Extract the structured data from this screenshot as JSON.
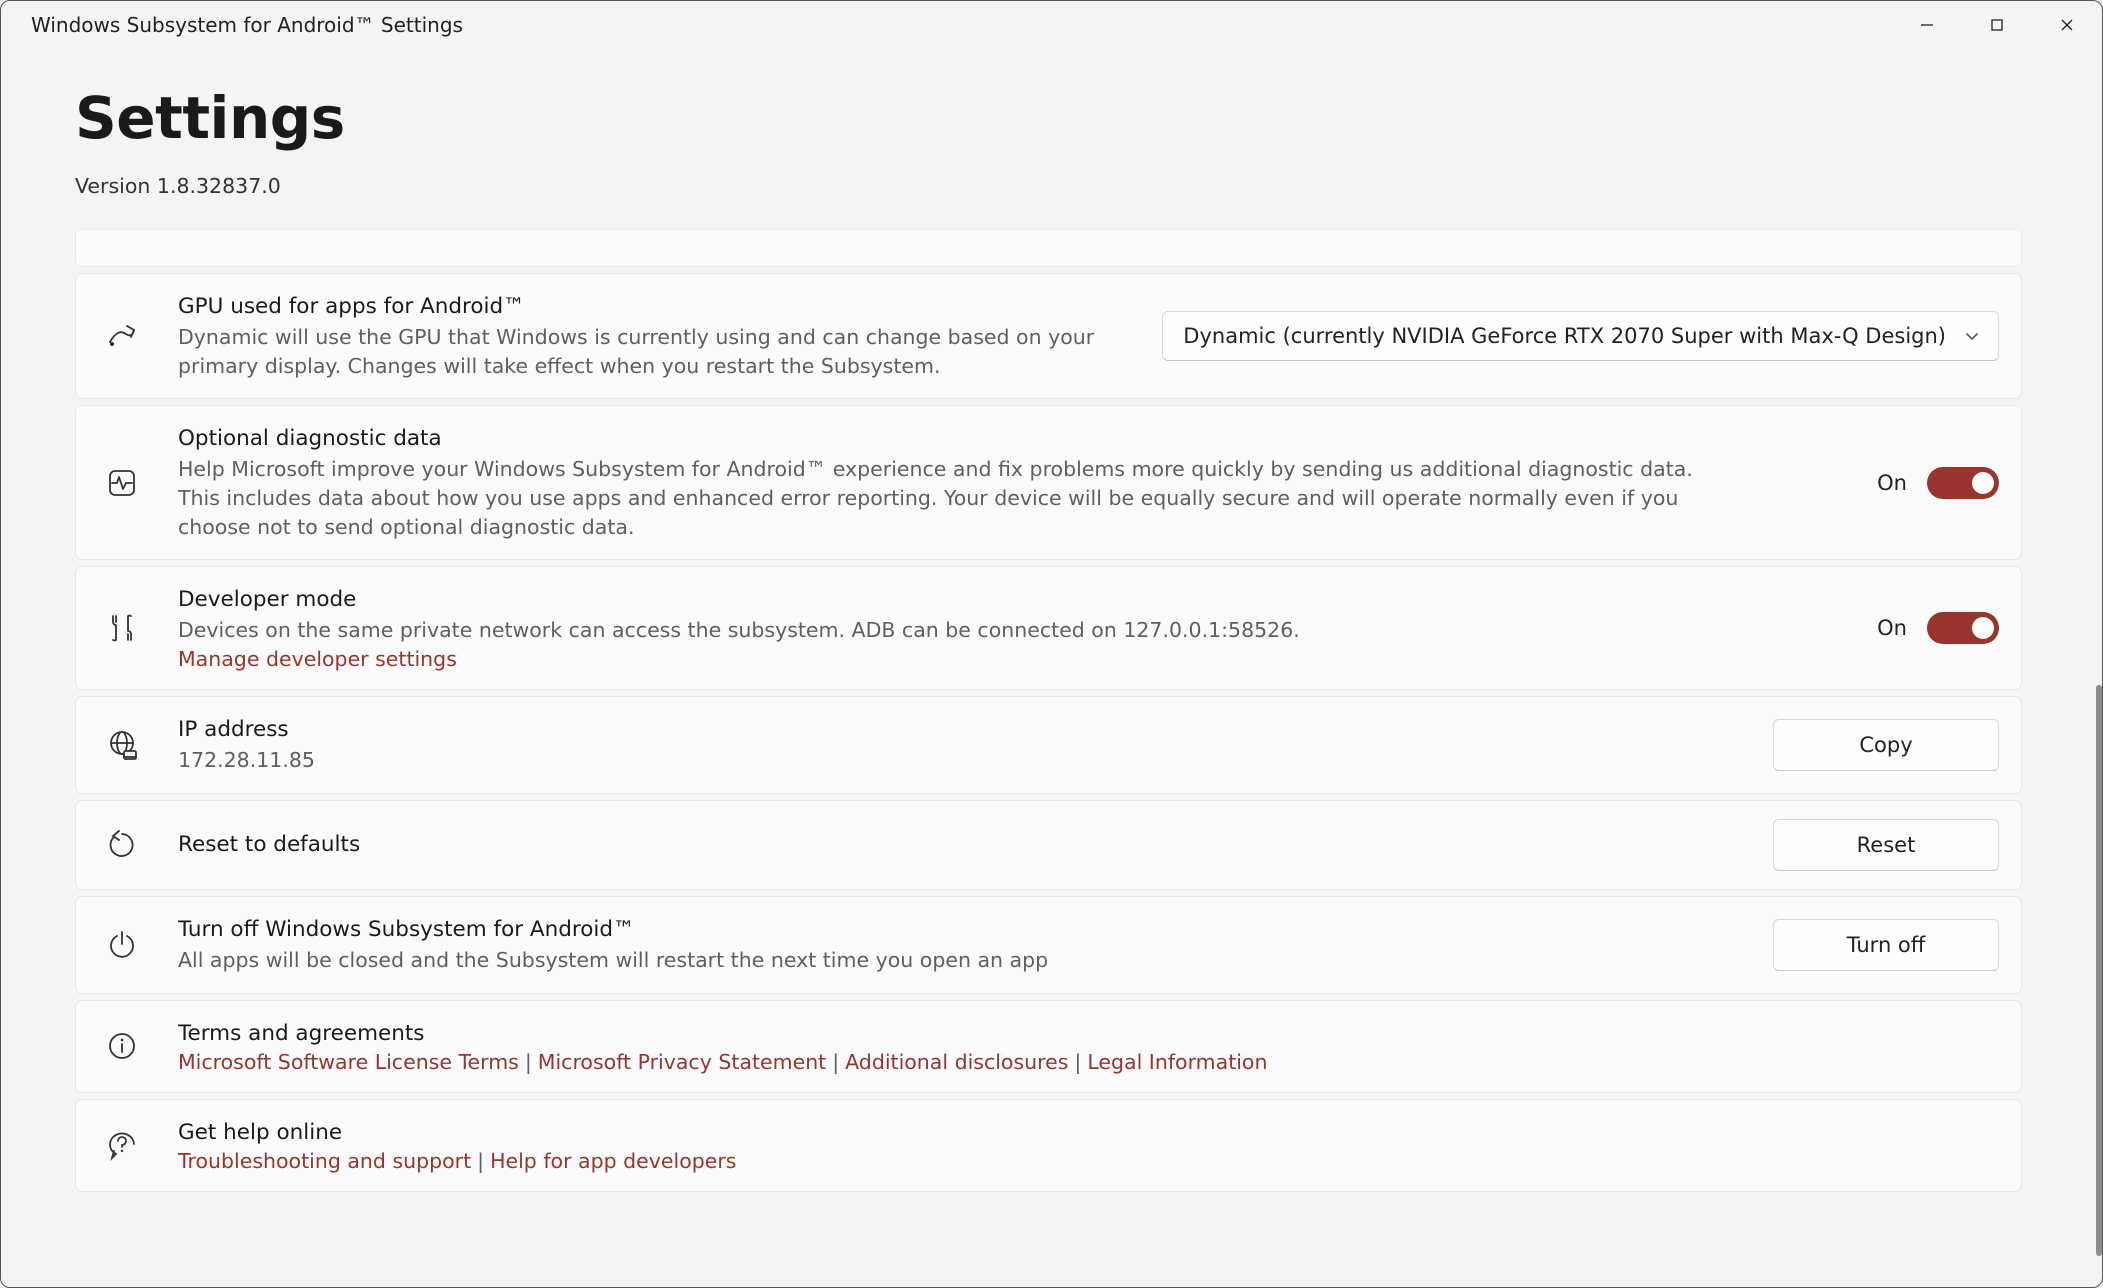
{
  "window": {
    "title": "Windows Subsystem for Android™ Settings"
  },
  "header": {
    "title": "Settings",
    "version": "Version 1.8.32837.0"
  },
  "gpu": {
    "title": "GPU used for apps for Android™",
    "desc": "Dynamic will use the GPU that Windows is currently using and can change based on your primary display. Changes will take effect when you restart the Subsystem.",
    "selected": "Dynamic (currently NVIDIA GeForce RTX 2070 Super with Max-Q Design)"
  },
  "diag": {
    "title": "Optional diagnostic data",
    "desc": "Help Microsoft improve your Windows Subsystem for Android™ experience and fix problems more quickly by sending us additional diagnostic data. This includes data about how you use apps and enhanced error reporting. Your device will be equally secure and will operate normally even if you choose not to send optional diagnostic data.",
    "state_label": "On",
    "state": true
  },
  "dev": {
    "title": "Developer mode",
    "desc": "Devices on the same private network can access the subsystem. ADB can be connected on 127.0.0.1:58526.",
    "link": "Manage developer settings",
    "state_label": "On",
    "state": true
  },
  "ip": {
    "title": "IP address",
    "value": "172.28.11.85",
    "button": "Copy"
  },
  "reset": {
    "title": "Reset to defaults",
    "button": "Reset"
  },
  "turnoff": {
    "title": "Turn off Windows Subsystem for Android™",
    "desc": "All apps will be closed and the Subsystem will restart the next time you open an app",
    "button": "Turn off"
  },
  "terms": {
    "title": "Terms and agreements",
    "links": [
      "Microsoft Software License Terms",
      "Microsoft Privacy Statement",
      "Additional disclosures",
      "Legal Information"
    ]
  },
  "help": {
    "title": "Get help online",
    "links": [
      "Troubleshooting and support",
      "Help for app developers"
    ]
  }
}
